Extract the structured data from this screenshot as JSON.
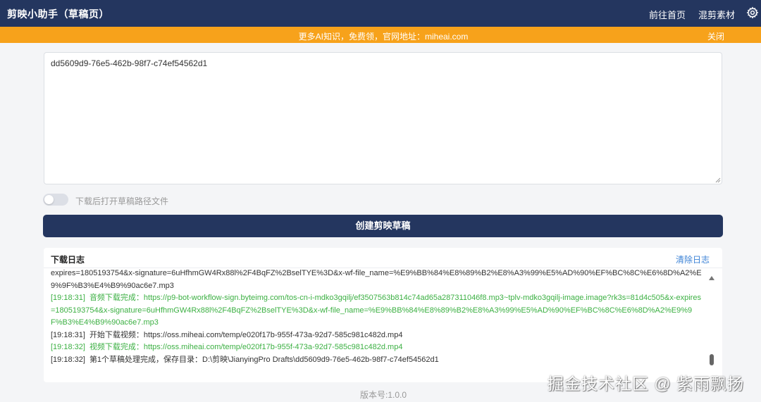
{
  "header": {
    "title": "剪映小助手（草稿页）",
    "nav": [
      {
        "label": "前往首页"
      },
      {
        "label": "混剪素材"
      }
    ],
    "settings_icon": "gear-icon"
  },
  "banner": {
    "message": "更多AI知识，免费领，官网地址：miheai.com",
    "close_label": "关闭",
    "bg_color": "#f7a21b"
  },
  "input": {
    "value": "dd5609d9-76e5-462b-98f7-c74ef54562d1"
  },
  "toggle": {
    "label": "下载后打开草稿路径文件",
    "checked": false
  },
  "create_button": {
    "label": "创建剪映草稿"
  },
  "log": {
    "title": "下载日志",
    "clear_label": "清除日志",
    "lines": [
      {
        "type": "info",
        "time": "",
        "text": "expires=1805193754&x-signature=6uHfhmGW4Rx88l%2F4BqFZ%2BselTYE%3D&x-wf-file_name=%E9%BB%84%E8%89%B2%E8%A3%99%E5%AD%90%EF%BC%8C%E6%8D%A2%E9%9F%B3%E4%B9%90ac6e7.mp3"
      },
      {
        "type": "success",
        "time": "[19:18:31]",
        "text": "音频下载完成：https://p9-bot-workflow-sign.byteimg.com/tos-cn-i-mdko3gqilj/ef3507563b814c74ad65a287311046f8.mp3~tplv-mdko3gqilj-image.image?rk3s=81d4c505&x-expires=1805193754&x-signature=6uHfhmGW4Rx88l%2F4BqFZ%2BselTYE%3D&x-wf-file_name=%E9%BB%84%E8%89%B2%E8%A3%99%E5%AD%90%EF%BC%8C%E6%8D%A2%E9%9F%B3%E4%B9%90ac6e7.mp3"
      },
      {
        "type": "info",
        "time": "[19:18:31]",
        "text": "开始下载视频：https://oss.miheai.com/temp/e020f17b-955f-473a-92d7-585c981c482d.mp4"
      },
      {
        "type": "success",
        "time": "[19:18:32]",
        "text": "视频下载完成：https://oss.miheai.com/temp/e020f17b-955f-473a-92d7-585c981c482d.mp4"
      },
      {
        "type": "info",
        "time": "[19:18:32]",
        "text": "第1个草稿处理完成，保存目录：D:\\剪映\\JianyingPro Drafts\\dd5609d9-76e5-462b-98f7-c74ef54562d1"
      }
    ]
  },
  "version": "版本号:1.0.0",
  "watermark": "掘金技术社区 @ 紫雨飘扬"
}
